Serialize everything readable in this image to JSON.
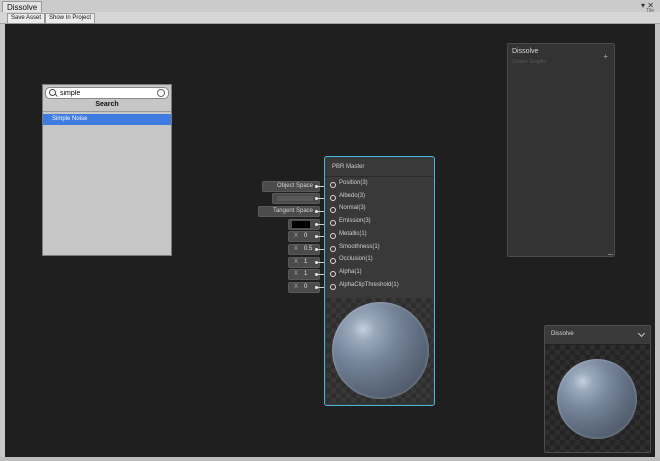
{
  "window": {
    "tab_title": "Dissolve",
    "controls": "▾ ✕",
    "controls_sub": "Tile"
  },
  "toolbar": {
    "save_asset": "Save Asset",
    "show_in_project": "Show In Project"
  },
  "searcher": {
    "query": "simple",
    "header": "Search",
    "results": [
      "Simple Noise"
    ]
  },
  "master_node": {
    "title": "PBR Master",
    "slots": [
      {
        "label": "Position(3)",
        "input": {
          "kind": "text",
          "value": "Object Space"
        }
      },
      {
        "label": "Albedo(3)",
        "input": {
          "kind": "blank"
        }
      },
      {
        "label": "Normal(3)",
        "input": {
          "kind": "text",
          "value": "Tangent Space"
        }
      },
      {
        "label": "Emission(3)",
        "input": {
          "kind": "color",
          "color": "#000000"
        }
      },
      {
        "label": "Metallic(1)",
        "input": {
          "kind": "num",
          "axis": "X",
          "value": "0"
        }
      },
      {
        "label": "Smoothness(1)",
        "input": {
          "kind": "num",
          "axis": "X",
          "value": "0.5"
        }
      },
      {
        "label": "Occlusion(1)",
        "input": {
          "kind": "num",
          "axis": "X",
          "value": "1"
        }
      },
      {
        "label": "Alpha(1)",
        "input": {
          "kind": "num",
          "axis": "X",
          "value": "1"
        }
      },
      {
        "label": "AlphaClipThreshold(1)",
        "input": {
          "kind": "num",
          "axis": "X",
          "value": "0"
        }
      }
    ]
  },
  "blackboard": {
    "title": "Dissolve",
    "subtitle": "Shader Graphs",
    "add_symbol": "+"
  },
  "main_preview": {
    "title": "Dissolve"
  },
  "colors": {
    "canvas": "#1f1f1f",
    "node_border": "#47b8d8",
    "selection": "#3e7ce0"
  }
}
